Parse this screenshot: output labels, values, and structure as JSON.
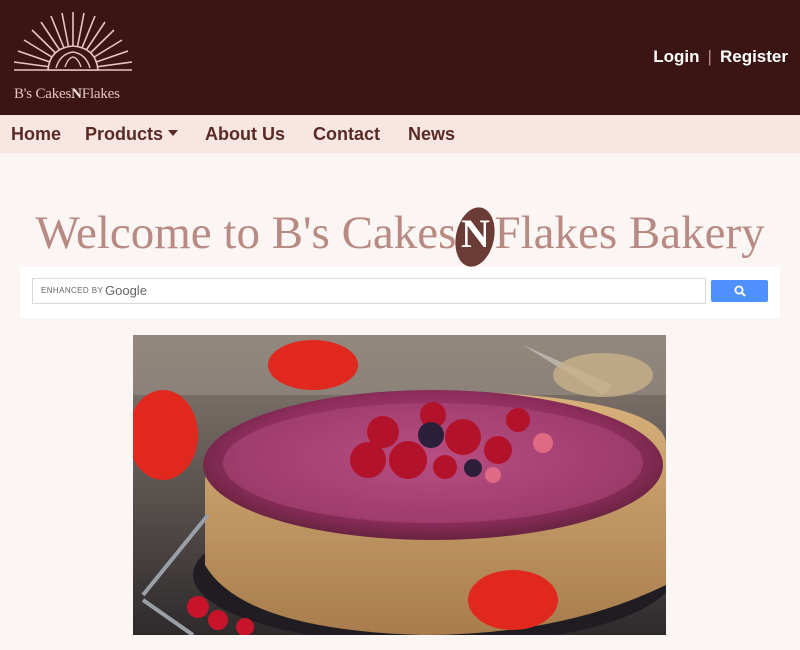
{
  "header": {
    "logo": {
      "name": "B's Cakes",
      "mark": "N",
      "suffix": "Flakes"
    },
    "login_label": "Login",
    "separator": "|",
    "register_label": "Register"
  },
  "nav": {
    "items": [
      "Home",
      "Products",
      "About Us",
      "Contact",
      "News"
    ]
  },
  "main": {
    "welcome_before": "Welcome to B's Cakes",
    "welcome_mark": "N",
    "welcome_after": "Flakes Bakery"
  },
  "search": {
    "enhanced_label": "ENHANCED BY",
    "provider": "Google",
    "button_icon": "search-icon"
  },
  "colors": {
    "header_bg": "#3a1514",
    "nav_bg": "#f8e6e2",
    "accent": "#b98a83",
    "search_button": "#4d90fe"
  }
}
